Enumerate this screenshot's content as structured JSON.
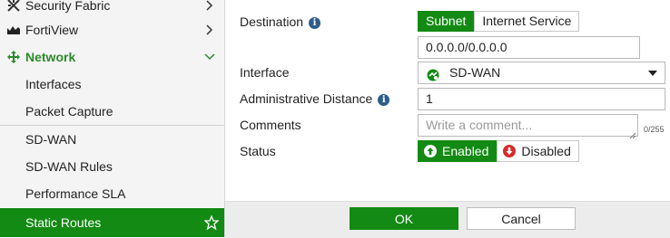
{
  "sidebar": {
    "items": [
      {
        "label": "Security Fabric",
        "icon": "security-fabric-icon"
      },
      {
        "label": "FortiView",
        "icon": "fortiview-icon"
      },
      {
        "label": "Network",
        "icon": "network-icon"
      },
      {
        "label": "Interfaces"
      },
      {
        "label": "Packet Capture"
      },
      {
        "label": "SD-WAN"
      },
      {
        "label": "SD-WAN Rules"
      },
      {
        "label": "Performance SLA"
      },
      {
        "label": "Static Routes",
        "icon": "star-icon"
      }
    ]
  },
  "form": {
    "destination": {
      "label": "Destination",
      "tabs": [
        "Subnet",
        "Internet Service"
      ],
      "selected": "Subnet",
      "value": "0.0.0.0/0.0.0.0"
    },
    "interface": {
      "label": "Interface",
      "value": "SD-WAN",
      "icon": "sdwan-icon"
    },
    "admin_distance": {
      "label": "Administrative Distance",
      "value": "1"
    },
    "comments": {
      "label": "Comments",
      "placeholder": "Write a comment...",
      "counter": "0/255"
    },
    "status": {
      "label": "Status",
      "enabled_label": "Enabled",
      "disabled_label": "Disabled",
      "selected": "Enabled"
    }
  },
  "footer": {
    "ok_label": "OK",
    "cancel_label": "Cancel"
  },
  "colors": {
    "accent": "#138a13",
    "info": "#2d5d8a",
    "disabled_red": "#d62c2c"
  }
}
